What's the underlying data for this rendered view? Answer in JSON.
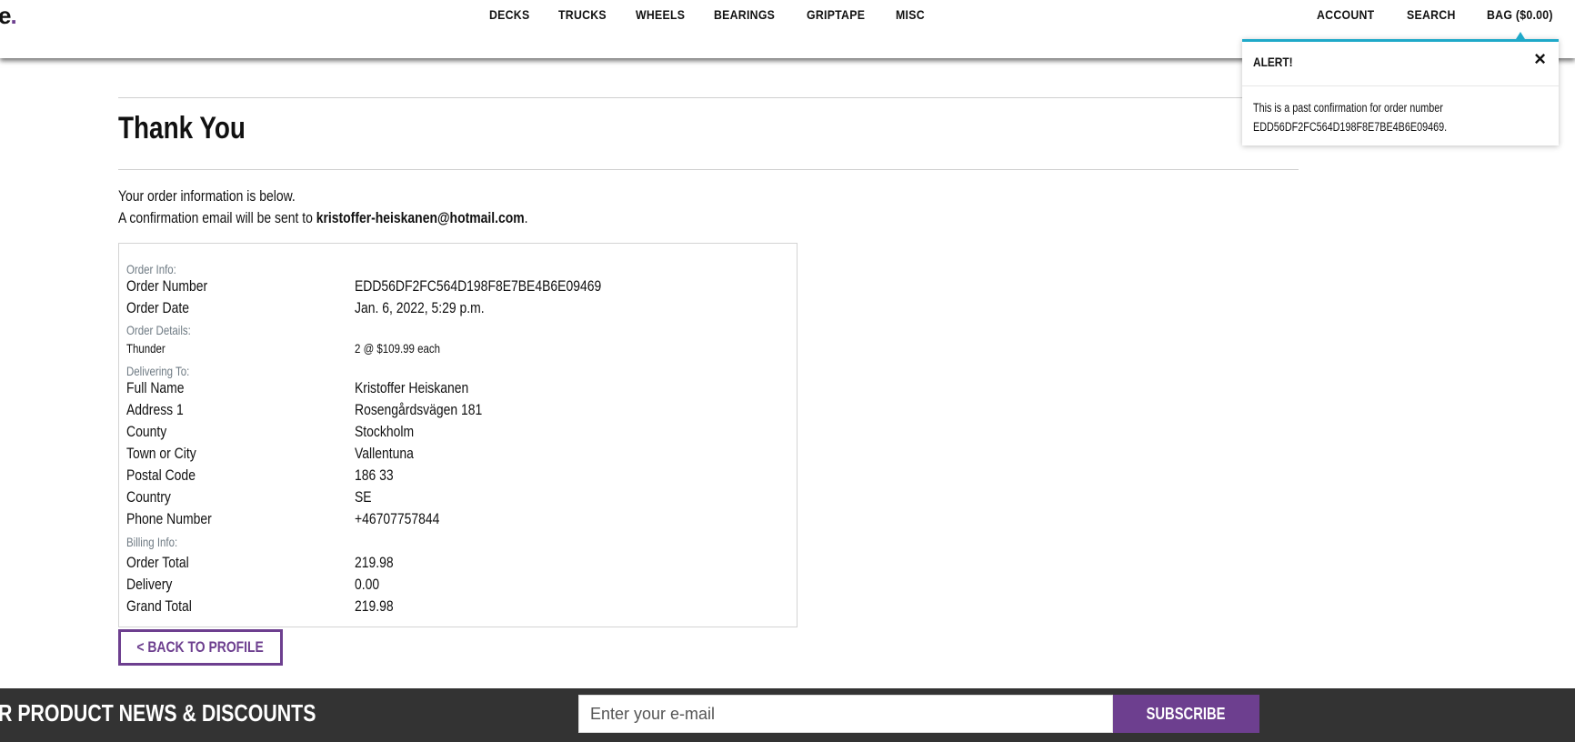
{
  "header": {
    "logo_text": "e",
    "logo_dot": ".",
    "nav": [
      "DECKS",
      "TRUCKS",
      "WHEELS",
      "BEARINGS",
      "GRIPTAPE",
      "MISC"
    ],
    "account_label": "ACCOUNT",
    "search_label": "SEARCH",
    "bag_label": "BAG ($0.00)"
  },
  "alert": {
    "title": "ALERT!",
    "close_icon": "×",
    "message_line1": "This is a past confirmation for order number",
    "message_line2": "EDD56DF2FC564D198F8E7BE4B6E09469."
  },
  "page": {
    "title": "Thank You",
    "intro_line1": "Your order information is below.",
    "intro_line2_prefix": "A confirmation email will be sent to ",
    "email": "kristoffer-heiskanen@hotmail.com",
    "intro_line2_suffix": "."
  },
  "order": {
    "order_info_heading": "Order Info:",
    "order_number_label": "Order Number",
    "order_number": "EDD56DF2FC564D198F8E7BE4B6E09469",
    "order_date_label": "Order Date",
    "order_date": "Jan. 6, 2022, 5:29 p.m.",
    "order_details_heading": "Order Details:",
    "item_name": "Thunder",
    "item_qty_price": "2 @ $109.99 each",
    "delivering_heading": "Delivering To:",
    "full_name_label": "Full Name",
    "full_name": "Kristoffer Heiskanen",
    "address1_label": "Address 1",
    "address1": "Rosengårdsvägen 181",
    "county_label": "County",
    "county": "Stockholm",
    "town_label": "Town or City",
    "town": "Vallentuna",
    "postal_label": "Postal Code",
    "postal": "186 33",
    "country_label": "Country",
    "country": "SE",
    "phone_label": "Phone Number",
    "phone": "+46707757844",
    "billing_heading": "Billing Info:",
    "order_total_label": "Order Total",
    "order_total": "219.98",
    "delivery_label": "Delivery",
    "delivery": "0.00",
    "grand_total_label": "Grand Total",
    "grand_total": "219.98"
  },
  "back_button": "< BACK TO PROFILE",
  "footer": {
    "newsletter_text": "R PRODUCT NEWS & DISCOUNTS",
    "email_placeholder": "Enter your e-mail",
    "subscribe_label": "SUBSCRIBE"
  },
  "colors": {
    "brand_purple": "#6d3f8f",
    "alert_accent": "#1fa9c9",
    "footer_bg": "#333333"
  }
}
